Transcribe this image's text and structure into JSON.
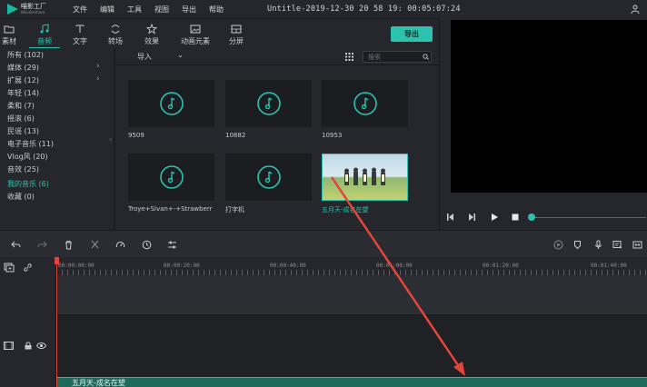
{
  "app": {
    "logo_text": "喵影工厂",
    "logo_sub": "Wondershare",
    "title": "Untitle-2019-12-30 20 58 19: 00:05:07:24"
  },
  "menu": [
    "文件",
    "编辑",
    "工具",
    "视图",
    "导出",
    "帮助"
  ],
  "tabs": [
    {
      "label": "素材",
      "icon": "folder-icon"
    },
    {
      "label": "音频",
      "icon": "music-note-icon",
      "active": true
    },
    {
      "label": "文字",
      "icon": "text-icon"
    },
    {
      "label": "转场",
      "icon": "transition-icon"
    },
    {
      "label": "效果",
      "icon": "effects-icon"
    },
    {
      "label": "动画元素",
      "icon": "image-icon"
    },
    {
      "label": "分屏",
      "icon": "split-screen-icon"
    }
  ],
  "export_label": "导出",
  "categories": [
    {
      "label": "所有 (102)"
    },
    {
      "label": "媒体 (29)",
      "expand": true
    },
    {
      "label": "扩展 (12)",
      "expand": true
    },
    {
      "label": "年轻 (14)"
    },
    {
      "label": "柔和 (7)"
    },
    {
      "label": "摇滚 (6)"
    },
    {
      "label": "民谣 (13)"
    },
    {
      "label": "电子音乐 (11)"
    },
    {
      "label": "Vlog风 (20)"
    },
    {
      "label": "音效 (25)"
    },
    {
      "label": "我的音乐 (6)",
      "active": true
    },
    {
      "label": "收藏 (0)"
    }
  ],
  "media_toolbar": {
    "import_label": "导入",
    "search_placeholder": "搜索"
  },
  "media_items": [
    {
      "label": "9509"
    },
    {
      "label": "10882"
    },
    {
      "label": "10953"
    },
    {
      "label": "Troye+Sivan+-+Strawberr"
    },
    {
      "label": "打字机"
    },
    {
      "label": "五月天-成名在望",
      "selected": true
    }
  ],
  "timeline": {
    "ruler_labels": [
      "00:00:00:00",
      "00:00:20:00",
      "00:00:40:00",
      "00:01:00:00",
      "00:01:20:00",
      "00:01:40:00"
    ],
    "clip_label": "五月天-成名在望"
  },
  "colors": {
    "accent": "#2bc3b0",
    "playhead": "#e2453c",
    "annotation_arrow": "#e2453c"
  }
}
